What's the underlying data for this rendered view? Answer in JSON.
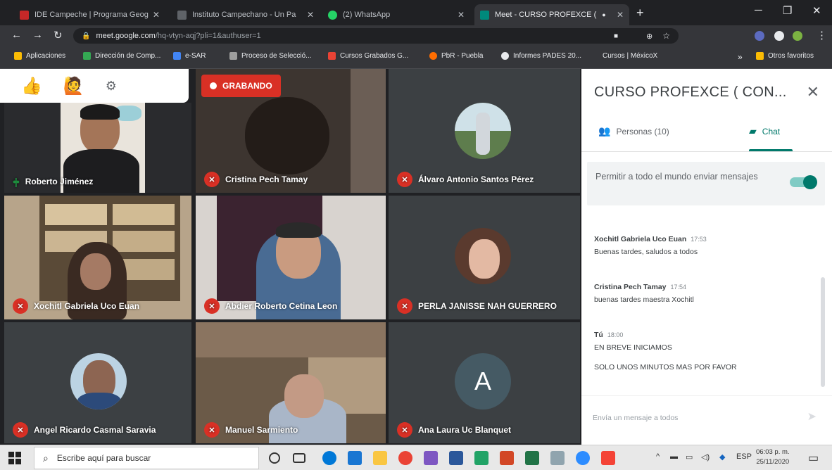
{
  "browser": {
    "tabs": [
      {
        "title": "IDE Campeche | Programa Geog",
        "color": "#c62828",
        "active": false
      },
      {
        "title": "Instituto Campechano - Un Pa",
        "color": "#5f6368",
        "active": false
      },
      {
        "title": "(2) WhatsApp",
        "color": "#25d366",
        "active": false
      },
      {
        "title": "Meet - CURSO PROFEXCE (",
        "color": "#00897b",
        "active": true
      }
    ],
    "url_host": "meet.google.com",
    "url_path": "/hq-vtyn-aqj?pli=1&authuser=1",
    "bookmarks": [
      {
        "label": "Aplicaciones",
        "color": "#fbbc04"
      },
      {
        "label": "Dirección de Comp...",
        "color": "#34a853"
      },
      {
        "label": "e-SAR",
        "color": "#4285f4"
      },
      {
        "label": "Proceso de Selecció...",
        "color": "#9e9e9e"
      },
      {
        "label": "Cursos Grabados G...",
        "color": "#ea4335"
      },
      {
        "label": "PbR - Puebla",
        "color": "#ff6d00"
      },
      {
        "label": "Informes PADES 20...",
        "color": "#e8eaed"
      },
      {
        "label": "Cursos | MéxicoX",
        "color": "#35363a"
      },
      {
        "label": "Otros favoritos",
        "color": "#fbbc04"
      }
    ]
  },
  "meet": {
    "recording_label": "GRABANDO",
    "participants": [
      {
        "name": "Roberto Jiménez",
        "speaking": true
      },
      {
        "name": "Cristina Pech Tamay",
        "speaking": false
      },
      {
        "name": "Álvaro Antonio Santos Pérez",
        "speaking": false
      },
      {
        "name": "Xochitl Gabriela Uco Euan",
        "speaking": false
      },
      {
        "name": "Abdier Roberto Cetina Leon",
        "speaking": false
      },
      {
        "name": "PERLA JANISSE NAH GUERRERO",
        "speaking": false
      },
      {
        "name": "Angel Ricardo Casmal Saravia",
        "speaking": false
      },
      {
        "name": "Manuel Sarmiento",
        "speaking": false
      },
      {
        "name": "Ana Laura Uc Blanquet",
        "speaking": false,
        "initial": "A"
      }
    ]
  },
  "panel": {
    "title": "CURSO PROFEXCE ( CON...",
    "people_tab": "Personas (10)",
    "chat_tab": "Chat",
    "allow_label": "Permitir a todo el mundo enviar mensajes",
    "allow_enabled": true,
    "messages": [
      {
        "author": "Xochitl Gabriela Uco Euan",
        "time": "17:53",
        "lines": [
          "Buenas tardes, saludos a todos"
        ]
      },
      {
        "author": "Cristina Pech Tamay",
        "time": "17:54",
        "lines": [
          "buenas tardes maestra Xochitl"
        ]
      },
      {
        "author": "Tú",
        "time": "18:00",
        "lines": [
          "EN BREVE INICIAMOS",
          "SOLO UNOS MINUTOS MAS POR FAVOR"
        ]
      }
    ],
    "composer_placeholder": "Envía un mensaje a todos"
  },
  "taskbar": {
    "search_placeholder": "Escribe aquí para buscar",
    "language": "ESP",
    "time": "06:03 p. m.",
    "date": "25/11/2020"
  }
}
